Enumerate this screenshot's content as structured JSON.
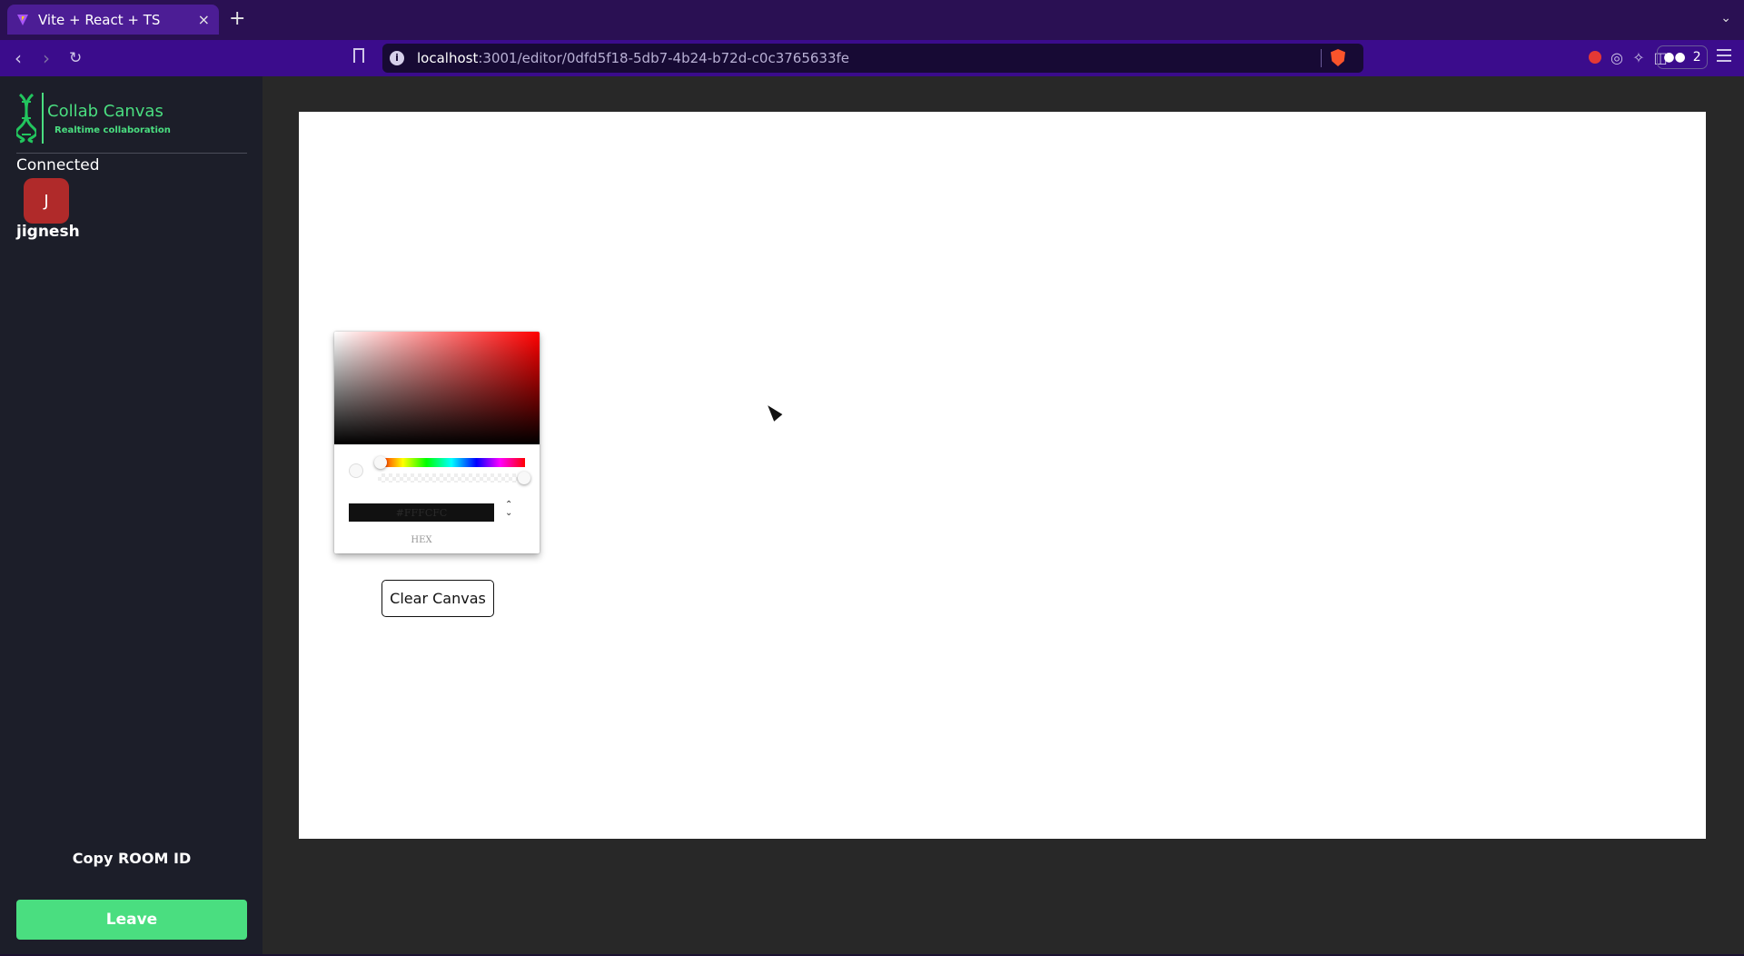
{
  "browser": {
    "tab_title": "Vite + React + TS",
    "url_host": "localhost",
    "url_rest": ":3001/editor/0dfd5f18-5db7-4b24-b72d-c0c3765633fe",
    "wallet_count": "2",
    "info_glyph": "i"
  },
  "sidebar": {
    "app_name": "Collab Canvas",
    "tagline": "Realtime collaboration",
    "status": "Connected",
    "users": [
      {
        "initial": "J",
        "name": "jignesh",
        "color": "#b02a2a"
      }
    ],
    "copy_room_label": "Copy ROOM ID",
    "leave_label": "Leave",
    "accent_color": "#4ade80"
  },
  "picker": {
    "hex_value": "#FFFCFC",
    "mode_label": "HEX"
  },
  "canvas": {
    "clear_label": "Clear Canvas"
  }
}
